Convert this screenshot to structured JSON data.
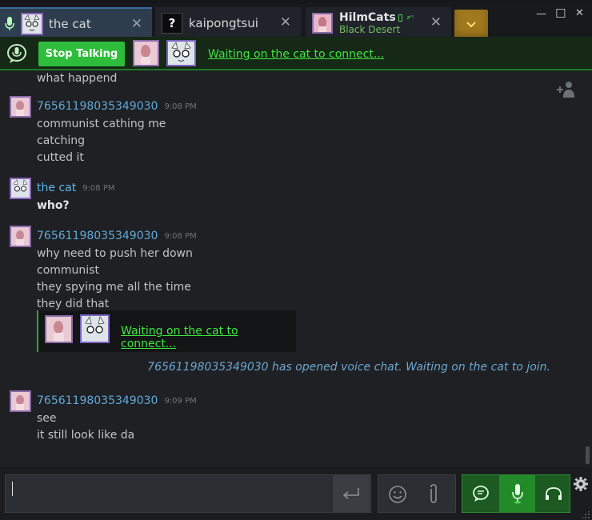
{
  "tabs": [
    {
      "name": "the cat",
      "active": true
    },
    {
      "name": "kaipongtsui",
      "avatar_glyph": "?"
    },
    {
      "name": "HilmCats",
      "status": "Black Desert",
      "away_glyph": "zᶻᶻ"
    }
  ],
  "window": {
    "minimize": "—",
    "maximize": "☐",
    "close": "✕"
  },
  "voice": {
    "stop_label": "Stop Talking",
    "waiting_text": "Waiting on the cat to connect..."
  },
  "messages": [
    {
      "lines": [
        "what happend"
      ]
    },
    {
      "sender": "76561198035349030",
      "time": "9:08 PM",
      "lines": [
        "communist cathing me",
        "catching",
        "cutted it"
      ]
    },
    {
      "sender": "the cat",
      "time": "9:08 PM",
      "lines": [
        "who?"
      ],
      "self": true
    },
    {
      "sender": "76561198035349030",
      "time": "9:08 PM",
      "lines": [
        "why need to push her down",
        "communist",
        "they spying me all the time",
        "they did that"
      ]
    },
    {
      "sender": "76561198035349030",
      "time": "9:09 PM",
      "lines": [
        "see",
        "it still look like da"
      ]
    }
  ],
  "inline_voice": {
    "waiting_text": "Waiting on the cat to connect..."
  },
  "system_message": "76561198035349030 has opened voice chat. Waiting on the cat to join.",
  "input": {
    "value": ""
  },
  "colors": {
    "accent_green": "#2dbd3b",
    "link_green": "#3fe63f",
    "name_blue": "#62a9d6",
    "tab_active": "#2d3d4d"
  },
  "icons": [
    "mic-icon",
    "voice-chat-icon",
    "emoji-icon",
    "attach-icon",
    "headset-icon",
    "send-icon",
    "gear-icon",
    "add-friend-icon",
    "chevron-down-icon"
  ]
}
